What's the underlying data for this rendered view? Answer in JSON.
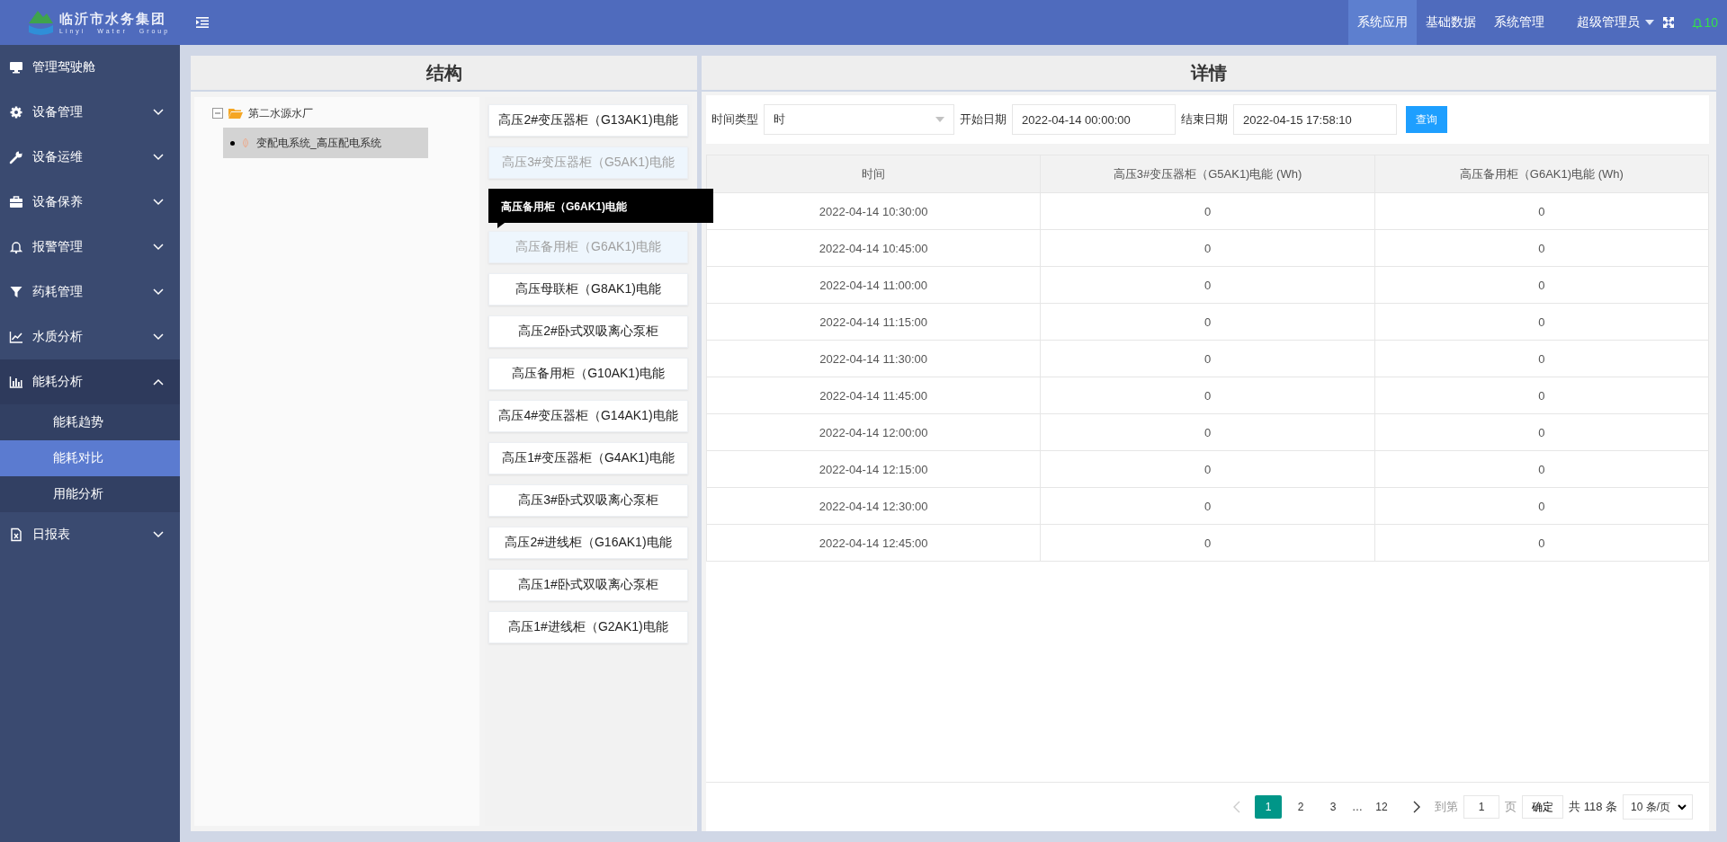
{
  "header": {
    "logo_title": "临沂市水务集团",
    "logo_subtitle": "Linyi Water Group",
    "nav": [
      {
        "label": "系统应用",
        "selected": true
      },
      {
        "label": "基础数据",
        "selected": false
      },
      {
        "label": "系统管理",
        "selected": false
      }
    ],
    "user": "超级管理员",
    "notifications": "10"
  },
  "sidebar": {
    "items": [
      {
        "label": "管理驾驶舱",
        "selected": false
      },
      {
        "label": "设备管理",
        "expanded": false,
        "selected": false
      },
      {
        "label": "设备运维",
        "expanded": false,
        "selected": false
      },
      {
        "label": "设备保养",
        "expanded": false,
        "selected": false
      },
      {
        "label": "报警管理",
        "expanded": false,
        "selected": false
      },
      {
        "label": "药耗管理",
        "expanded": false,
        "selected": false
      },
      {
        "label": "水质分析",
        "expanded": false,
        "selected": false
      },
      {
        "label": "能耗分析",
        "expanded": true,
        "selected": true,
        "children": [
          {
            "label": "能耗趋势",
            "selected": false
          },
          {
            "label": "能耗对比",
            "selected": true
          },
          {
            "label": "用能分析",
            "selected": false
          }
        ]
      },
      {
        "label": "日报表",
        "expanded": false,
        "selected": false
      }
    ]
  },
  "structure": {
    "title": "结构",
    "tree": [
      {
        "label": "第二水源水厂",
        "expanded": true,
        "children": [
          {
            "label": "变配电系统_高压配电系统",
            "selected": true
          }
        ]
      }
    ],
    "devices": [
      {
        "kind": "device",
        "label": "高压2#变压器柜（G13AK1)电能",
        "selected": false
      },
      {
        "kind": "device",
        "label": "高压3#变压器柜（G5AK1)电能",
        "selected": true
      },
      {
        "kind": "tooltip",
        "label": "高压备用柜（G6AK1)电能"
      },
      {
        "kind": "device",
        "label": "高压备用柜（G6AK1)电能",
        "selected": true
      },
      {
        "kind": "device",
        "label": "高压母联柜（G8AK1)电能",
        "selected": false
      },
      {
        "kind": "device",
        "label": "高压2#卧式双吸离心泵柜",
        "selected": false
      },
      {
        "kind": "device",
        "label": "高压备用柜（G10AK1)电能",
        "selected": false
      },
      {
        "kind": "device",
        "label": "高压4#变压器柜（G14AK1)电能",
        "selected": false
      },
      {
        "kind": "device",
        "label": "高压1#变压器柜（G4AK1)电能",
        "selected": false
      },
      {
        "kind": "device",
        "label": "高压3#卧式双吸离心泵柜",
        "selected": false
      },
      {
        "kind": "device",
        "label": "高压2#进线柜（G16AK1)电能",
        "selected": false
      },
      {
        "kind": "device",
        "label": "高压1#卧式双吸离心泵柜",
        "selected": false
      },
      {
        "kind": "device",
        "label": "高压1#进线柜（G2AK1)电能",
        "selected": false
      }
    ]
  },
  "detail": {
    "title": "详情",
    "filters": {
      "time_type_label": "时间类型",
      "time_type_value": "时",
      "start_label": "开始日期",
      "start_value": "2022-04-14 00:00:00",
      "end_label": "结束日期",
      "end_value": "2022-04-15 17:58:10",
      "query_button": "查询"
    },
    "table": {
      "columns": [
        "时间",
        "高压3#变压器柜（G5AK1)电能 (Wh)",
        "高压备用柜（G6AK1)电能 (Wh)"
      ],
      "rows": [
        [
          "2022-04-14 10:30:00",
          "0",
          "0"
        ],
        [
          "2022-04-14 10:45:00",
          "0",
          "0"
        ],
        [
          "2022-04-14 11:00:00",
          "0",
          "0"
        ],
        [
          "2022-04-14 11:15:00",
          "0",
          "0"
        ],
        [
          "2022-04-14 11:30:00",
          "0",
          "0"
        ],
        [
          "2022-04-14 11:45:00",
          "0",
          "0"
        ],
        [
          "2022-04-14 12:00:00",
          "0",
          "0"
        ],
        [
          "2022-04-14 12:15:00",
          "0",
          "0"
        ],
        [
          "2022-04-14 12:30:00",
          "0",
          "0"
        ],
        [
          "2022-04-14 12:45:00",
          "0",
          "0"
        ]
      ]
    },
    "pagination": {
      "pages": [
        {
          "kind": "page",
          "label": "1",
          "selected": true
        },
        {
          "kind": "page",
          "label": "2",
          "selected": false
        },
        {
          "kind": "page",
          "label": "3",
          "selected": false
        },
        {
          "kind": "ellipsis",
          "label": "…"
        },
        {
          "kind": "page",
          "label": "12",
          "selected": false
        }
      ],
      "goto_label": "到第",
      "goto_value": "1",
      "page_unit": "页",
      "confirm": "确定",
      "total": "共 118 条",
      "page_size": "10 条/页"
    }
  }
}
